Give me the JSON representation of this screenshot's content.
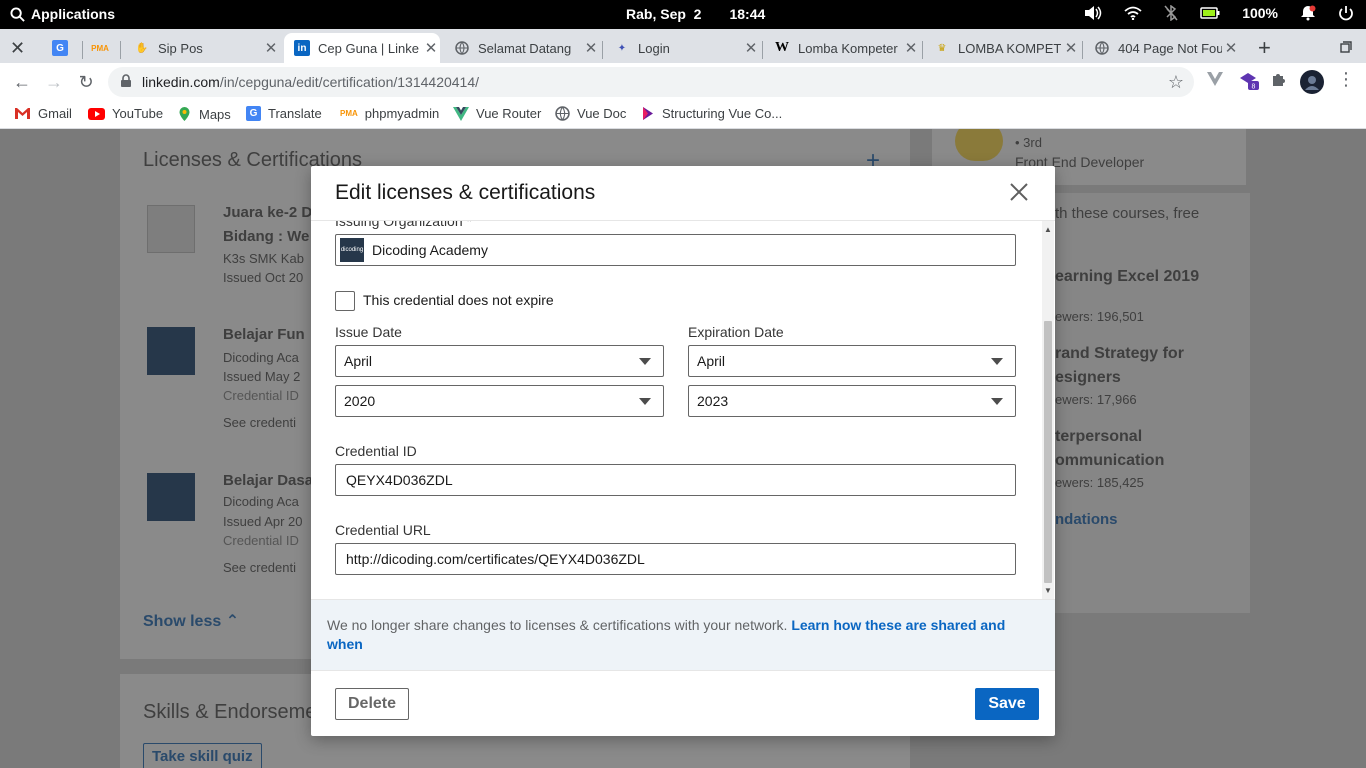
{
  "system": {
    "apps_label": "Applications",
    "date": "Rab, Sep  2",
    "time": "18:44",
    "battery": "100%"
  },
  "tabs": [
    {
      "title": "",
      "icon": "close-icon"
    },
    {
      "title": "",
      "icon": "google-translate-icon"
    },
    {
      "title": "",
      "icon": "phpmyadmin-icon"
    },
    {
      "title": "Sip Pos",
      "icon": "hand-icon"
    },
    {
      "title": "Cep Guna | Linke",
      "icon": "linkedin-icon"
    },
    {
      "title": "Selamat Datang",
      "icon": "globe-icon"
    },
    {
      "title": "Login",
      "icon": "bird-icon"
    },
    {
      "title": "Lomba Kompeter",
      "icon": "wikipedia-icon"
    },
    {
      "title": "LOMBA KOMPETI",
      "icon": "emblem-icon"
    },
    {
      "title": "404 Page Not Fou",
      "icon": "globe-icon"
    }
  ],
  "address": {
    "host": "linkedin.com",
    "path": "/in/cepguna/edit/certification/1314420414/"
  },
  "bookmarks": [
    {
      "label": "Gmail",
      "icon": "gmail-icon"
    },
    {
      "label": "YouTube",
      "icon": "youtube-icon"
    },
    {
      "label": "Maps",
      "icon": "maps-icon"
    },
    {
      "label": "Translate",
      "icon": "translate-icon"
    },
    {
      "label": "phpmyadmin",
      "icon": "phpmyadmin-icon"
    },
    {
      "label": "Vue Router",
      "icon": "vue-icon"
    },
    {
      "label": "Vue Doc",
      "icon": "globe-icon"
    },
    {
      "label": "Structuring Vue Co...",
      "icon": "bookmark-icon"
    }
  ],
  "background": {
    "section_title": "Licenses & Certifications",
    "item1_title": "Juara ke-2 D",
    "item1_sub": "Bidang : We",
    "item1_org": "K3s SMK Kab",
    "item1_date": "Issued Oct 20",
    "item2_title": "Belajar Fun",
    "item2_org": "Dicoding Aca",
    "item2_date": "Issued May 2",
    "item2_cred": "Credential ID",
    "item2_see": "See credenti",
    "item3_title": "Belajar Dasa",
    "item3_org": "Dicoding Aca",
    "item3_date": "Issued Apr 20",
    "item3_cred": "Credential ID",
    "item3_see": "See credenti",
    "show_less": "Show less",
    "skills_title": "Skills & Endorseme",
    "skill_quiz": "Take skill quiz",
    "right_degree": "• 3rd",
    "right_role": "Front End Developer",
    "right_learning": "th these courses, free",
    "course1": "earning Excel 2019",
    "course1_views": "ewers: 196,501",
    "course2": "rand Strategy for",
    "course2b": "esigners",
    "course2_views": "ewers: 17,966",
    "course3": "terpersonal",
    "course3b": "ommunication",
    "course3_views": "ewers: 185,425",
    "recommendations": "ndations"
  },
  "modal": {
    "title": "Edit licenses & certifications",
    "issuing_org_label": "Issuing Organization *",
    "issuing_org_value": "Dicoding Academy",
    "no_expire_label": "This credential does not expire",
    "issue_date_label": "Issue Date",
    "issue_month": "April",
    "issue_year": "2020",
    "expiration_date_label": "Expiration Date",
    "expiration_month": "April",
    "expiration_year": "2023",
    "credential_id_label": "Credential ID",
    "credential_id_value": "QEYX4D036ZDL",
    "credential_url_label": "Credential URL",
    "credential_url_value": "http://dicoding.com/certificates/QEYX4D036ZDL",
    "notice_text": "We no longer share changes to licenses & certifications with your network. ",
    "notice_link": "Learn how these are shared and when",
    "delete_label": "Delete",
    "save_label": "Save"
  },
  "colors": {
    "linkedin_blue": "#0a66c2",
    "notice_bg": "#eef3f8"
  }
}
